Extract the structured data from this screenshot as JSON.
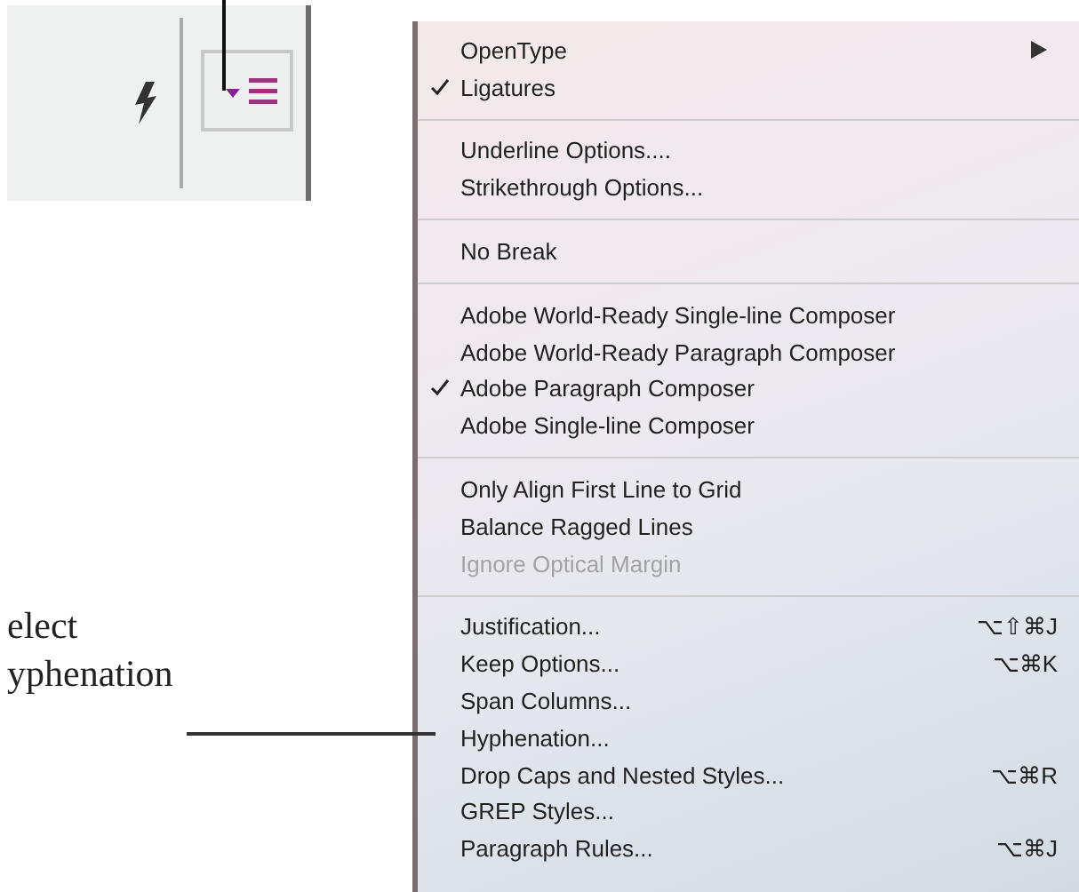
{
  "callout": {
    "lines": [
      "elect",
      "yphenation"
    ]
  },
  "menu": {
    "items": [
      {
        "kind": "item",
        "label": "OpenType",
        "checked": false,
        "disabled": false,
        "submenu": true
      },
      {
        "kind": "item",
        "label": "Ligatures",
        "checked": true,
        "disabled": false,
        "submenu": false
      },
      {
        "kind": "separator"
      },
      {
        "kind": "item",
        "label": "Underline Options....",
        "checked": false,
        "disabled": false,
        "submenu": false
      },
      {
        "kind": "item",
        "label": "Strikethrough Options...",
        "checked": false,
        "disabled": false,
        "submenu": false
      },
      {
        "kind": "separator"
      },
      {
        "kind": "item",
        "label": "No Break",
        "checked": false,
        "disabled": false,
        "submenu": false
      },
      {
        "kind": "separator"
      },
      {
        "kind": "item",
        "label": "Adobe World-Ready Single-line Composer",
        "checked": false,
        "disabled": false,
        "submenu": false
      },
      {
        "kind": "item",
        "label": "Adobe World-Ready Paragraph Composer",
        "checked": false,
        "disabled": false,
        "submenu": false
      },
      {
        "kind": "item",
        "label": "Adobe Paragraph Composer",
        "checked": true,
        "disabled": false,
        "submenu": false
      },
      {
        "kind": "item",
        "label": "Adobe Single-line Composer",
        "checked": false,
        "disabled": false,
        "submenu": false
      },
      {
        "kind": "separator"
      },
      {
        "kind": "item",
        "label": "Only Align First Line to Grid",
        "checked": false,
        "disabled": false,
        "submenu": false
      },
      {
        "kind": "item",
        "label": "Balance Ragged Lines",
        "checked": false,
        "disabled": false,
        "submenu": false
      },
      {
        "kind": "item",
        "label": "Ignore Optical Margin",
        "checked": false,
        "disabled": true,
        "submenu": false
      },
      {
        "kind": "separator"
      },
      {
        "kind": "item",
        "label": "Justification...",
        "checked": false,
        "disabled": false,
        "submenu": false,
        "shortcut": "⌥⇧⌘J"
      },
      {
        "kind": "item",
        "label": "Keep Options...",
        "checked": false,
        "disabled": false,
        "submenu": false,
        "shortcut": "⌥⌘K"
      },
      {
        "kind": "item",
        "label": "Span Columns...",
        "checked": false,
        "disabled": false,
        "submenu": false
      },
      {
        "kind": "item",
        "label": "Hyphenation...",
        "checked": false,
        "disabled": false,
        "submenu": false
      },
      {
        "kind": "item",
        "label": "Drop Caps and Nested Styles...",
        "checked": false,
        "disabled": false,
        "submenu": false,
        "shortcut": "⌥⌘R"
      },
      {
        "kind": "item",
        "label": "GREP Styles...",
        "checked": false,
        "disabled": false,
        "submenu": false
      },
      {
        "kind": "item",
        "label": "Paragraph Rules...",
        "checked": false,
        "disabled": false,
        "submenu": false,
        "shortcut": "⌥⌘J"
      }
    ]
  }
}
